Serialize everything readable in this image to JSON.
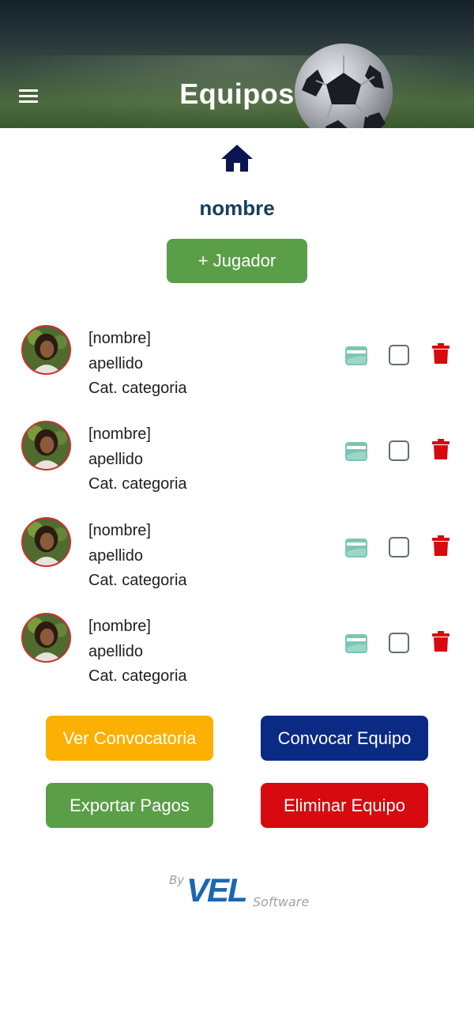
{
  "header": {
    "title": "Equipos",
    "menu_icon": "hamburger-menu-icon",
    "background": "soccer-field-photo"
  },
  "home_icon": "home-icon",
  "team": {
    "name": "nombre",
    "add_player_label": "+ Jugador"
  },
  "players": [
    {
      "name": "[nombre]",
      "surname": "apellido",
      "category": "Cat. categoria",
      "checked": false
    },
    {
      "name": "[nombre]",
      "surname": "apellido",
      "category": "Cat. categoria",
      "checked": false
    },
    {
      "name": "[nombre]",
      "surname": "apellido",
      "category": "Cat. categoria",
      "checked": false
    },
    {
      "name": "[nombre]",
      "surname": "apellido",
      "category": "Cat. categoria",
      "checked": false
    }
  ],
  "actions": {
    "ver_convocatoria": "Ver Convocatoria",
    "convocar_equipo": "Convocar Equipo",
    "exportar_pagos": "Exportar Pagos",
    "eliminar_equipo": "Eliminar Equipo"
  },
  "footer": {
    "by": "By",
    "brand": "VEL",
    "software": "Software"
  },
  "colors": {
    "green": "#5a9e47",
    "yellow": "#fbb003",
    "blue": "#0b2a84",
    "red": "#d60a0f",
    "team_name": "#153f5a",
    "card_teal": "#7cc5b3"
  }
}
